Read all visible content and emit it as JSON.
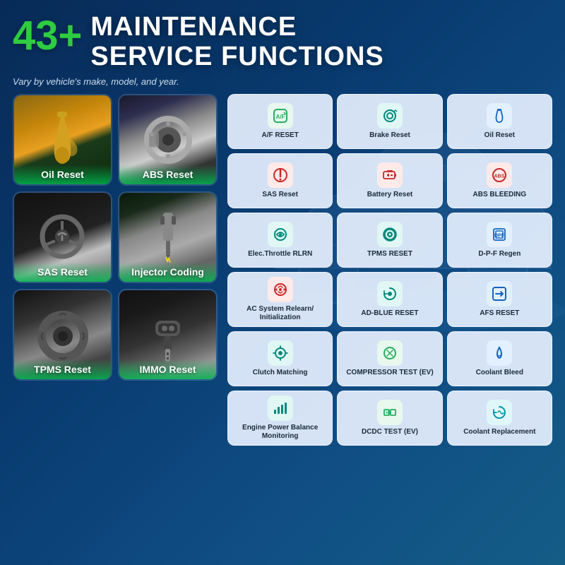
{
  "header": {
    "number": "43+",
    "line1": "MAINTENANCE",
    "line2": "SERVICE FUNCTIONS",
    "subtitle": "Vary by vehicle's make, model, and year."
  },
  "photoCards": [
    {
      "id": "oil-reset",
      "label": "Oil Reset",
      "bgClass": "oil-reset-photo"
    },
    {
      "id": "abs-reset",
      "label": "ABS Reset",
      "bgClass": "abs-reset-photo"
    },
    {
      "id": "sas-reset",
      "label": "SAS Reset",
      "bgClass": "sas-reset-photo"
    },
    {
      "id": "injector-coding",
      "label": "Injector Coding",
      "bgClass": "injector-photo"
    },
    {
      "id": "tpms-reset",
      "label": "TPMS Reset",
      "bgClass": "tpms-photo"
    },
    {
      "id": "immo-reset",
      "label": "IMMO Reset",
      "bgClass": "immo-photo"
    }
  ],
  "funcCards": [
    {
      "id": "af-reset",
      "label": "A/F RESET",
      "iconColor": "icon-green",
      "icon": "⚙"
    },
    {
      "id": "brake-reset",
      "label": "Brake Reset",
      "iconColor": "icon-teal",
      "icon": "🔄"
    },
    {
      "id": "oil-reset-f",
      "label": "Oil Reset",
      "iconColor": "icon-blue",
      "icon": "🛢"
    },
    {
      "id": "sas-reset-f",
      "label": "SAS Reset",
      "iconColor": "icon-red",
      "icon": "⚠"
    },
    {
      "id": "battery-reset",
      "label": "Battery Reset",
      "iconColor": "icon-red",
      "icon": "🔋"
    },
    {
      "id": "abs-bleeding",
      "label": "ABS BLEEDING",
      "iconColor": "icon-red",
      "icon": "◎"
    },
    {
      "id": "elec-throttle",
      "label": "Elec.Throttle RLRN",
      "iconColor": "icon-teal",
      "icon": "⭮"
    },
    {
      "id": "tpms-reset-f",
      "label": "TPMS RESET",
      "iconColor": "icon-teal",
      "icon": "◉"
    },
    {
      "id": "dpf-regen",
      "label": "D-P-F Regen",
      "iconColor": "icon-blue",
      "icon": "▣"
    },
    {
      "id": "ac-system",
      "label": "AC System Relearn/\nInitialization",
      "iconColor": "icon-red",
      "icon": "❄"
    },
    {
      "id": "ad-blue",
      "label": "AD-BLUE RESET",
      "iconColor": "icon-teal",
      "icon": "↺"
    },
    {
      "id": "afs-reset",
      "label": "AFS RESET",
      "iconColor": "icon-blue",
      "icon": "➡"
    },
    {
      "id": "clutch-match",
      "label": "Clutch Matching",
      "iconColor": "icon-teal",
      "icon": "⚙"
    },
    {
      "id": "compressor",
      "label": "COMPRESSOR TEST (EV)",
      "iconColor": "icon-green",
      "icon": "♻"
    },
    {
      "id": "coolant-bleed",
      "label": "Coolant Bleed",
      "iconColor": "icon-blue",
      "icon": "💧"
    },
    {
      "id": "engine-power",
      "label": "Engine Power Balance Monitoring",
      "iconColor": "icon-teal",
      "icon": "📊"
    },
    {
      "id": "dcdc-test",
      "label": "DCDC TEST (EV)",
      "iconColor": "icon-green",
      "icon": "⚡"
    },
    {
      "id": "coolant-repl",
      "label": "Coolant Replacement",
      "iconColor": "icon-cyan",
      "icon": "🔁"
    }
  ]
}
